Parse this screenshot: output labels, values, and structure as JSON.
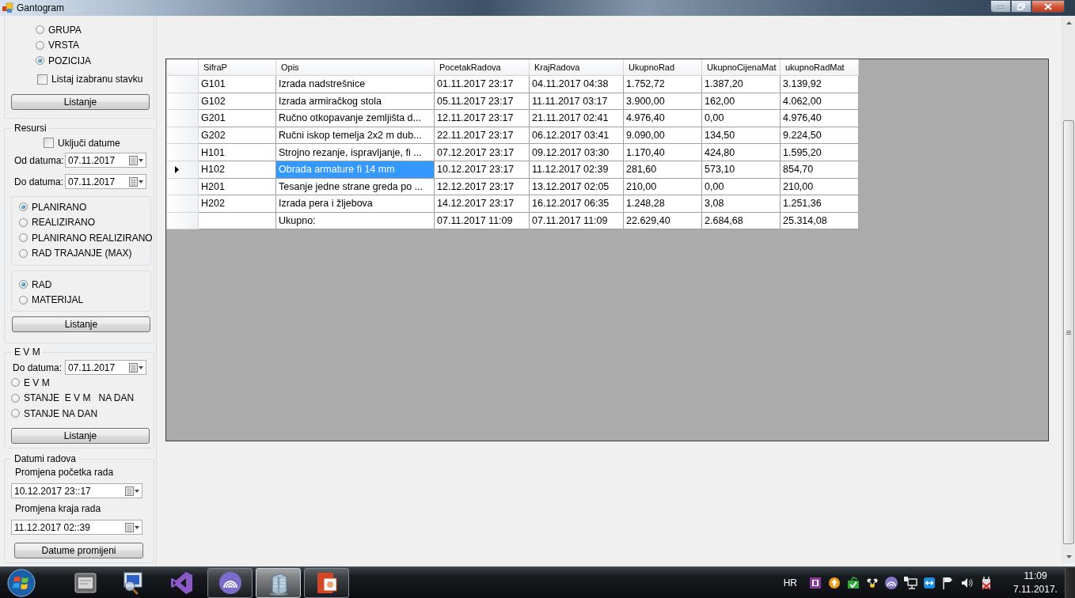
{
  "window": {
    "title": "Gantogram"
  },
  "selection_group": {
    "options": [
      {
        "label": "GRUPA",
        "selected": false
      },
      {
        "label": "VRSTA",
        "selected": false
      },
      {
        "label": "POZICIJA",
        "selected": true
      }
    ],
    "checkbox": {
      "label": "Listaj izabranu stavku",
      "checked": false
    },
    "button": "Listanje"
  },
  "resursi": {
    "title": "Resursi",
    "checkbox": {
      "label": "Uključi datume",
      "checked": false
    },
    "date_fields": [
      {
        "label": "Od datuma:",
        "value": "07.11.2017"
      },
      {
        "label": "Do datuma:",
        "value": "07.11.2017"
      }
    ],
    "type_options": [
      {
        "label": "PLANIRANO",
        "selected": true
      },
      {
        "label": "REALIZIRANO",
        "selected": false
      },
      {
        "label": "PLANIRANO REALIZIRANO",
        "selected": false
      },
      {
        "label": "RAD TRAJANJE (MAX)",
        "selected": false
      }
    ],
    "resource_options": [
      {
        "label": "RAD",
        "selected": true
      },
      {
        "label": "MATERIJAL",
        "selected": false
      }
    ],
    "button": "Listanje"
  },
  "evm": {
    "title": "E V M",
    "date_field": {
      "label": "Do datuma:",
      "value": "07.11.2017"
    },
    "options": [
      {
        "label": "E V M",
        "selected": false
      },
      {
        "label": "STANJE  E V M   NA DAN",
        "selected": false
      },
      {
        "label": "STANJE NA DAN",
        "selected": false
      }
    ],
    "button": "Listanje"
  },
  "datumi_radova": {
    "title": "Datumi radova",
    "fields": [
      {
        "label": "Promjena početka rada",
        "value": "10.12.2017 23::17"
      },
      {
        "label": "Promjena kraja rada",
        "value": "11.12.2017 02::39"
      }
    ],
    "button": "Datume promijeni"
  },
  "table": {
    "columns": [
      "SifraP",
      "Opis",
      "PocetakRadova",
      "KrajRadova",
      "UkupnoRad",
      "UkupnoCijenaMat",
      "ukupnoRadMat"
    ],
    "rows": [
      {
        "current": false,
        "cells": [
          {
            "text": "G101",
            "selected": false
          },
          {
            "text": "Izrada nadstrešnice",
            "selected": false
          },
          {
            "text": "01.11.2017 23:17",
            "selected": false
          },
          {
            "text": "04.11.2017 04:38",
            "selected": false
          },
          {
            "text": "1.752,72",
            "selected": false
          },
          {
            "text": "1.387,20",
            "selected": false
          },
          {
            "text": "3.139,92",
            "selected": false
          }
        ]
      },
      {
        "current": false,
        "cells": [
          {
            "text": "G102",
            "selected": false
          },
          {
            "text": "Izrada armiračkog stola",
            "selected": false
          },
          {
            "text": "05.11.2017 23:17",
            "selected": false
          },
          {
            "text": "11.11.2017 03:17",
            "selected": false
          },
          {
            "text": "3.900,00",
            "selected": false
          },
          {
            "text": "162,00",
            "selected": false
          },
          {
            "text": "4.062,00",
            "selected": false
          }
        ]
      },
      {
        "current": false,
        "cells": [
          {
            "text": "G201",
            "selected": false
          },
          {
            "text": "Ručno otkopavanje zemljišta d...",
            "selected": false
          },
          {
            "text": "12.11.2017 23:17",
            "selected": false
          },
          {
            "text": "21.11.2017 02:41",
            "selected": false
          },
          {
            "text": "4.976,40",
            "selected": false
          },
          {
            "text": "0,00",
            "selected": false
          },
          {
            "text": "4.976,40",
            "selected": false
          }
        ]
      },
      {
        "current": false,
        "cells": [
          {
            "text": "G202",
            "selected": false
          },
          {
            "text": "Ručni iskop temelja 2x2 m dub...",
            "selected": false
          },
          {
            "text": "22.11.2017 23:17",
            "selected": false
          },
          {
            "text": "06.12.2017 03:41",
            "selected": false
          },
          {
            "text": "9.090,00",
            "selected": false
          },
          {
            "text": "134,50",
            "selected": false
          },
          {
            "text": "9.224,50",
            "selected": false
          }
        ]
      },
      {
        "current": false,
        "cells": [
          {
            "text": "H101",
            "selected": false
          },
          {
            "text": "Strojno rezanje, ispravljanje, fi ...",
            "selected": false
          },
          {
            "text": "07.12.2017 23:17",
            "selected": false
          },
          {
            "text": "09.12.2017 03:30",
            "selected": false
          },
          {
            "text": "1.170,40",
            "selected": false
          },
          {
            "text": "424,80",
            "selected": false
          },
          {
            "text": "1.595,20",
            "selected": false
          }
        ]
      },
      {
        "current": true,
        "cells": [
          {
            "text": "H102",
            "selected": false
          },
          {
            "text": "Obrada armature fi 14 mm",
            "selected": true
          },
          {
            "text": "10.12.2017 23:17",
            "selected": false
          },
          {
            "text": "11.12.2017 02:39",
            "selected": false
          },
          {
            "text": "281,60",
            "selected": false
          },
          {
            "text": "573,10",
            "selected": false
          },
          {
            "text": "854,70",
            "selected": false
          }
        ]
      },
      {
        "current": false,
        "cells": [
          {
            "text": "H201",
            "selected": false
          },
          {
            "text": "Tesanje jedne strane greda po ...",
            "selected": false
          },
          {
            "text": "12.12.2017 23:17",
            "selected": false
          },
          {
            "text": "13.12.2017 02:05",
            "selected": false
          },
          {
            "text": "210,00",
            "selected": false
          },
          {
            "text": "0,00",
            "selected": false
          },
          {
            "text": "210,00",
            "selected": false
          }
        ]
      },
      {
        "current": false,
        "cells": [
          {
            "text": "H202",
            "selected": false
          },
          {
            "text": "Izrada pera i žljebova",
            "selected": false
          },
          {
            "text": "14.12.2017 23:17",
            "selected": false
          },
          {
            "text": "16.12.2017 06:35",
            "selected": false
          },
          {
            "text": "1.248,28",
            "selected": false
          },
          {
            "text": "3,08",
            "selected": false
          },
          {
            "text": "1.251,36",
            "selected": false
          }
        ]
      },
      {
        "current": false,
        "cells": [
          {
            "text": "",
            "selected": false
          },
          {
            "text": "Ukupno:",
            "selected": false
          },
          {
            "text": "07.11.2017 11:09",
            "selected": false
          },
          {
            "text": "07.11.2017 11:09",
            "selected": false
          },
          {
            "text": "22.629,40",
            "selected": false
          },
          {
            "text": "2.684,68",
            "selected": false
          },
          {
            "text": "25.314,08",
            "selected": false
          }
        ]
      }
    ]
  },
  "taskbar": {
    "apps": [
      {
        "running": false,
        "selected": false
      },
      {
        "running": false,
        "selected": false
      },
      {
        "running": false,
        "selected": false
      },
      {
        "running": true,
        "selected": false
      },
      {
        "running": true,
        "selected": true
      },
      {
        "running": true,
        "selected": false
      }
    ],
    "language": "HR",
    "time": "11:09",
    "date": "7.11.2017."
  }
}
